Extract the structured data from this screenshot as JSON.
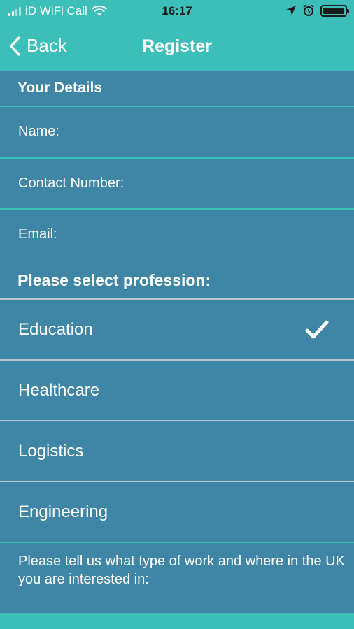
{
  "status_bar": {
    "carrier": "iD WiFi Call",
    "time": "16:17"
  },
  "nav": {
    "back_label": "Back",
    "title": "Register"
  },
  "details": {
    "header": "Your Details",
    "fields": [
      {
        "label": "Name:"
      },
      {
        "label": "Contact Number:"
      },
      {
        "label": "Email:"
      }
    ]
  },
  "profession": {
    "header": "Please select profession:",
    "options": [
      {
        "label": "Education",
        "selected": true
      },
      {
        "label": "Healthcare",
        "selected": false
      },
      {
        "label": "Logistics",
        "selected": false
      },
      {
        "label": "Engineering",
        "selected": false
      }
    ]
  },
  "work_prompt": "Please tell us what type of work and where in the UK you are interested in:",
  "colors": {
    "header_teal": "#3cbfb8",
    "body_blue": "#3f86a6",
    "text": "#ffffff"
  }
}
